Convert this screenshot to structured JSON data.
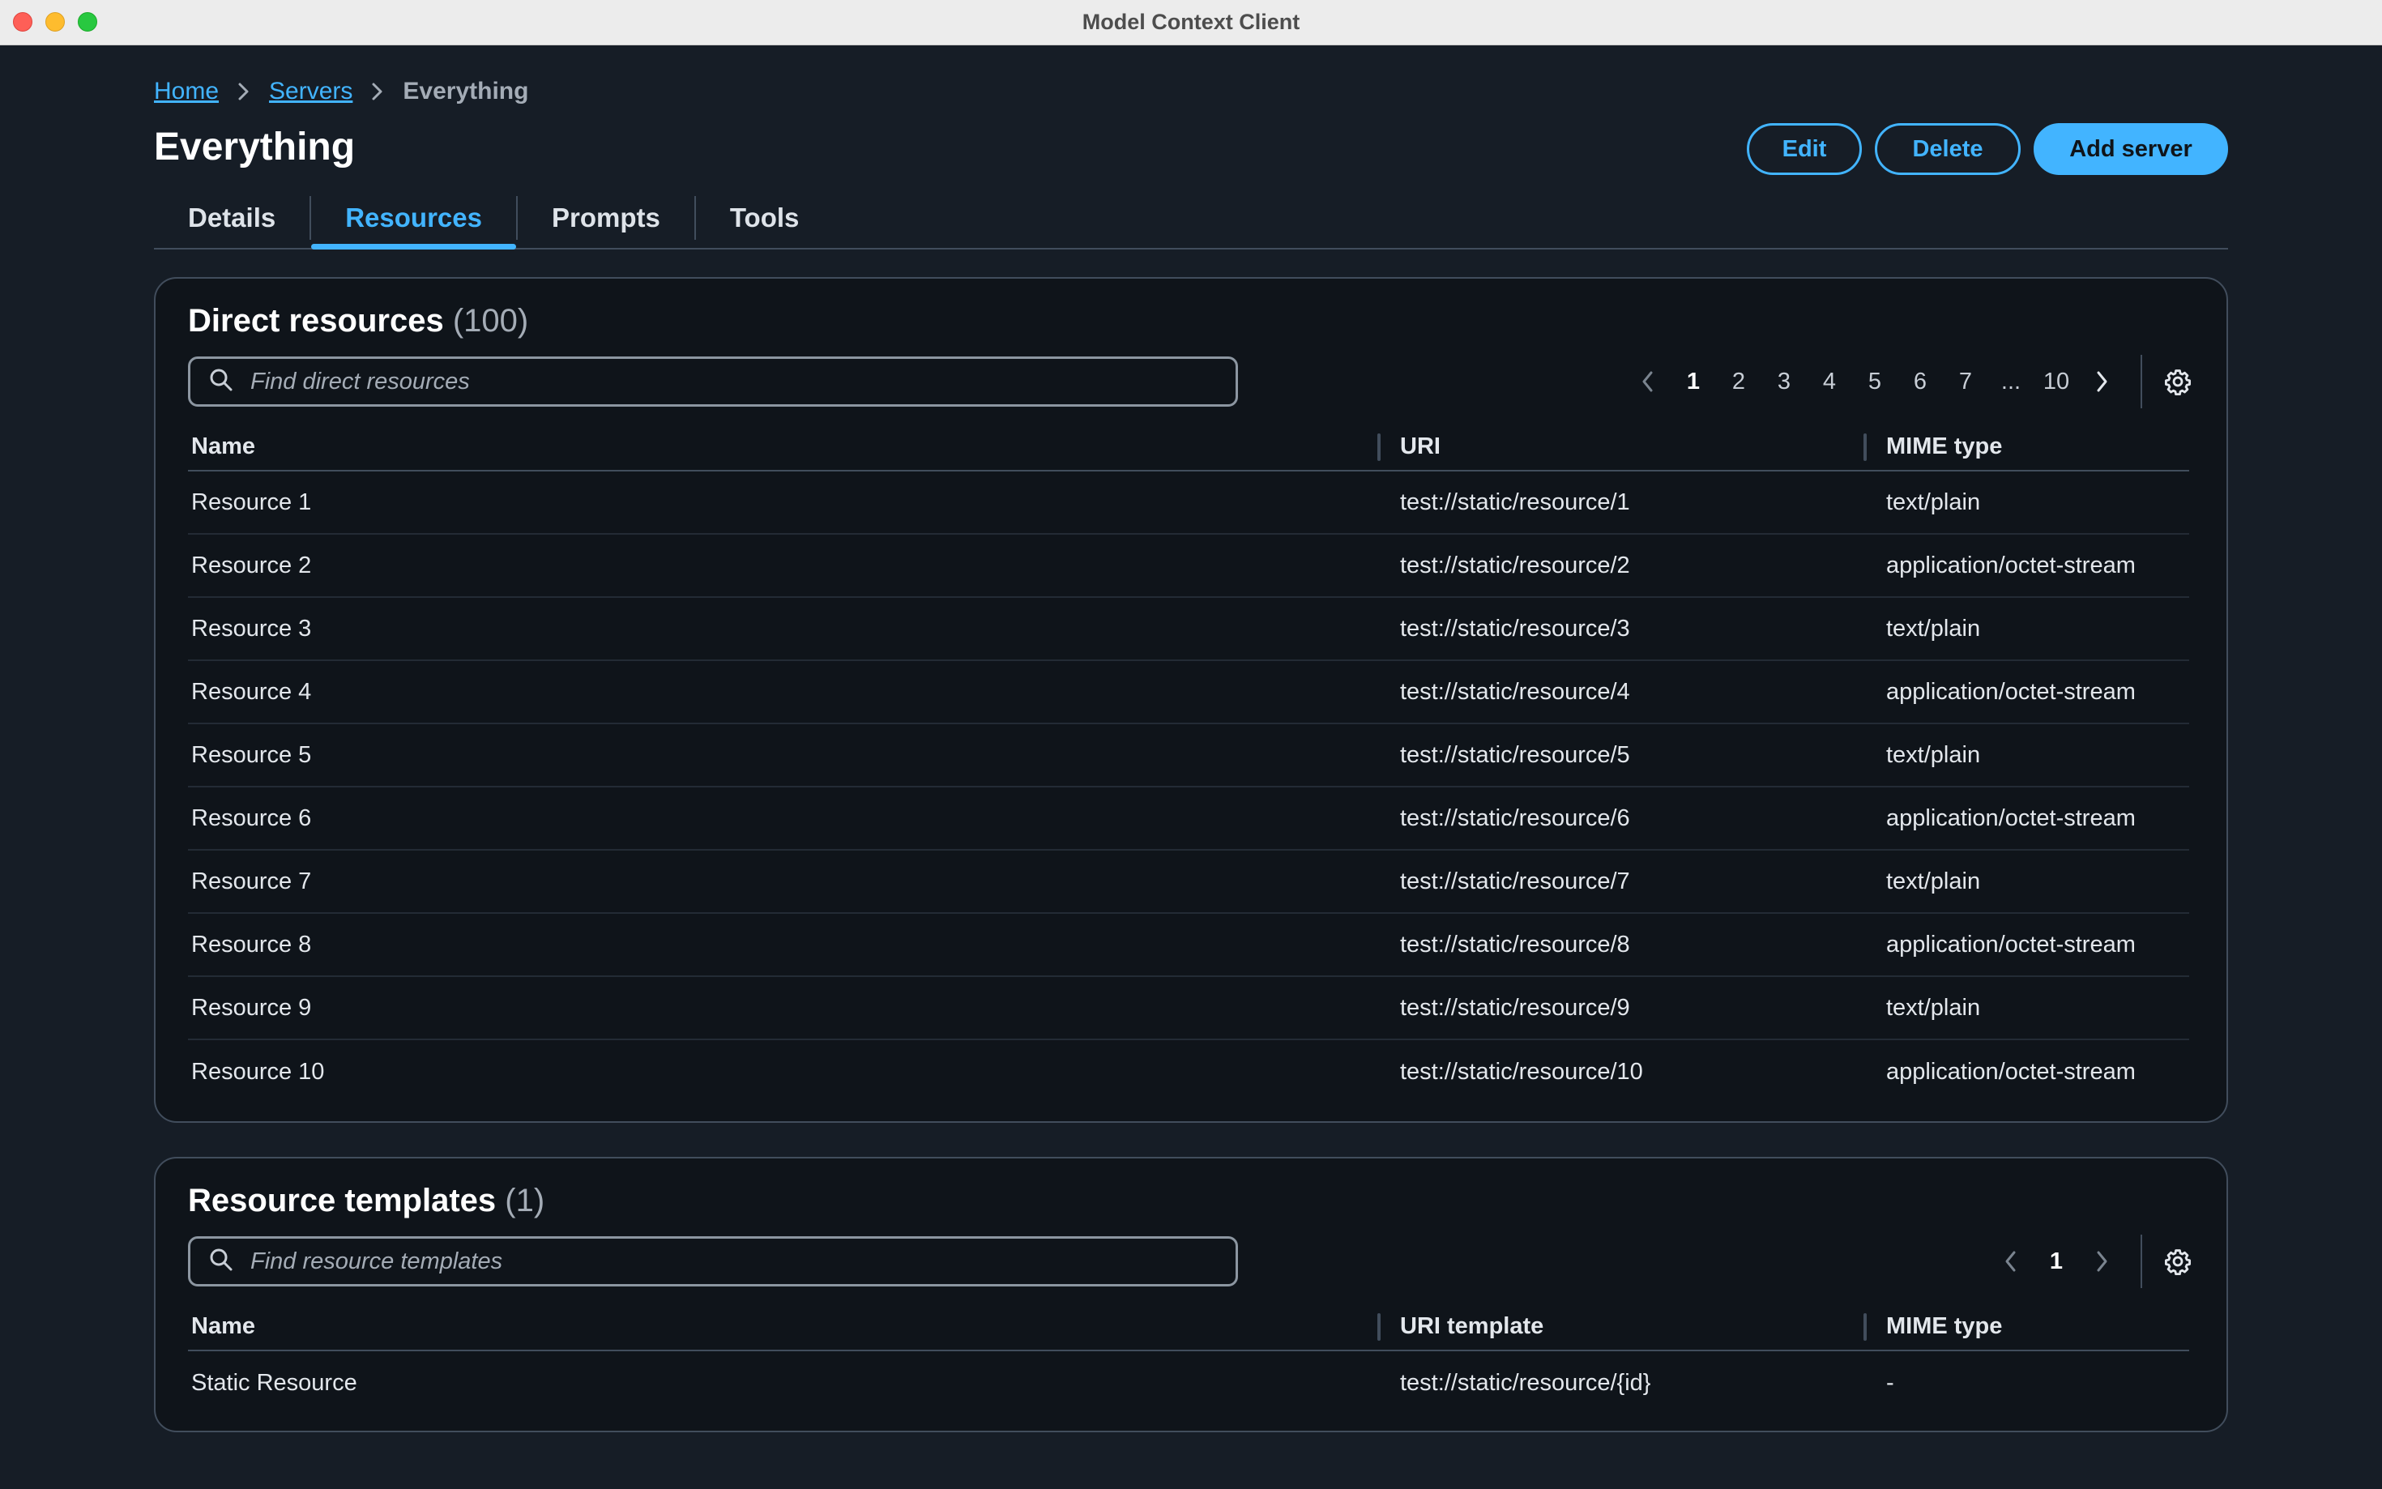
{
  "window": {
    "title": "Model Context Client"
  },
  "breadcrumb": {
    "home": "Home",
    "servers": "Servers",
    "current": "Everything"
  },
  "page": {
    "title": "Everything"
  },
  "actions": {
    "edit": "Edit",
    "delete": "Delete",
    "add": "Add server"
  },
  "tabs": [
    {
      "label": "Details",
      "active": false
    },
    {
      "label": "Resources",
      "active": true
    },
    {
      "label": "Prompts",
      "active": false
    },
    {
      "label": "Tools",
      "active": false
    }
  ],
  "direct": {
    "title": "Direct resources",
    "count": "(100)",
    "search_placeholder": "Find direct resources",
    "pages": [
      "1",
      "2",
      "3",
      "4",
      "5",
      "6",
      "7",
      "...",
      "10"
    ],
    "current_page": "1",
    "columns": [
      "Name",
      "URI",
      "MIME type"
    ],
    "rows": [
      [
        "Resource 1",
        "test://static/resource/1",
        "text/plain"
      ],
      [
        "Resource 2",
        "test://static/resource/2",
        "application/octet-stream"
      ],
      [
        "Resource 3",
        "test://static/resource/3",
        "text/plain"
      ],
      [
        "Resource 4",
        "test://static/resource/4",
        "application/octet-stream"
      ],
      [
        "Resource 5",
        "test://static/resource/5",
        "text/plain"
      ],
      [
        "Resource 6",
        "test://static/resource/6",
        "application/octet-stream"
      ],
      [
        "Resource 7",
        "test://static/resource/7",
        "text/plain"
      ],
      [
        "Resource 8",
        "test://static/resource/8",
        "application/octet-stream"
      ],
      [
        "Resource 9",
        "test://static/resource/9",
        "text/plain"
      ],
      [
        "Resource 10",
        "test://static/resource/10",
        "application/octet-stream"
      ]
    ]
  },
  "templates": {
    "title": "Resource templates",
    "count": "(1)",
    "search_placeholder": "Find resource templates",
    "pages": [
      "1"
    ],
    "current_page": "1",
    "columns": [
      "Name",
      "URI template",
      "MIME type"
    ],
    "rows": [
      [
        "Static Resource",
        "test://static/resource/{id}",
        "-"
      ]
    ]
  },
  "icons": {
    "search": "search-icon",
    "settings": "gear-icon",
    "prev": "chevron-left-icon",
    "next": "chevron-right-icon",
    "breadcrumb_separator": "chevron-right-icon"
  },
  "colors": {
    "accent": "#42b4ff",
    "background": "#161d26",
    "panel": "#0f141a",
    "border": "#414d5c"
  }
}
